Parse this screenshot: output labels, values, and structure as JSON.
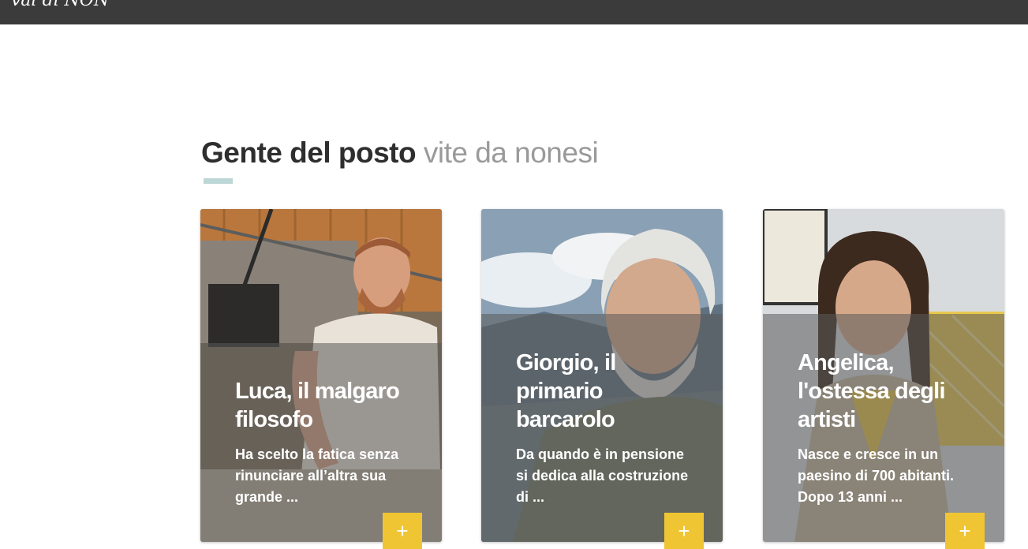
{
  "header": {
    "logo_text": "val di NON"
  },
  "section": {
    "title_strong": "Gente del posto",
    "title_light": "vite da nonesi"
  },
  "cards": [
    {
      "title": "Luca, il malgaro filosofo",
      "excerpt": "Ha scelto la fatica senza rinunciare all’altra sua grande ...",
      "button_label": "+"
    },
    {
      "title": "Giorgio, il primario barcarolo",
      "excerpt": "Da quando è in pensione si dedica alla costruzione di ...",
      "button_label": "+"
    },
    {
      "title": "Angelica, l'ostessa degli artisti",
      "excerpt": "Nasce e cresce in un paesino di 700 abitanti. Dopo 13 anni ...",
      "button_label": "+"
    }
  ],
  "colors": {
    "topbar": "#3b3b3b",
    "accent_button": "#f0c534",
    "heading_underline": "#bcd7d5"
  }
}
